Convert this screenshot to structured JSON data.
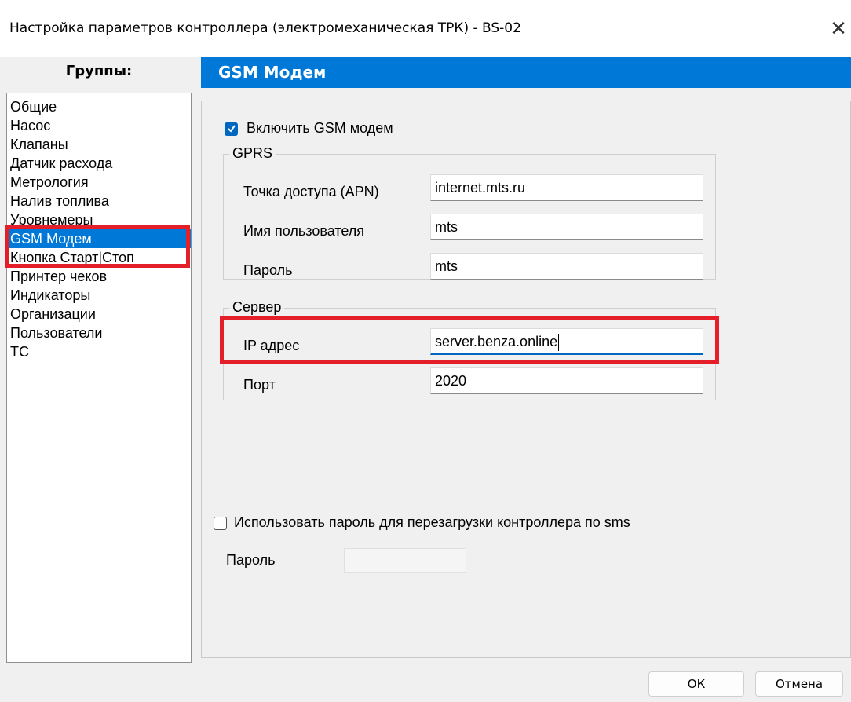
{
  "window": {
    "title": "Настройка параметров контроллера (электромеханическая ТРК) - BS-02",
    "close_glyph": "✕"
  },
  "groups": {
    "header": "Группы:",
    "items": [
      "Общие",
      "Насос",
      "Клапаны",
      "Датчик расхода",
      "Метрология",
      "Налив топлива",
      "Уровнемеры",
      "GSM Модем",
      "Кнопка Старт|Стоп",
      "Принтер чеков",
      "Индикаторы",
      "Организации",
      "Пользователи",
      "ТС"
    ],
    "selected": "GSM Модем"
  },
  "section": {
    "title": "GSM Модем"
  },
  "gsm": {
    "enable_label": "Включить GSM модем",
    "enable_checked": true
  },
  "gprs": {
    "title": "GPRS",
    "apn_label": "Точка доступа (APN)",
    "apn_value": "internet.mts.ru",
    "user_label": "Имя пользователя",
    "user_value": "mts",
    "password_label": "Пароль",
    "password_value": "mts"
  },
  "server": {
    "title": "Сервер",
    "ip_label": "IP адрес",
    "ip_value": "server.benza.online",
    "port_label": "Порт",
    "port_value": "2020"
  },
  "sms": {
    "use_password_label": "Использовать пароль для перезагрузки контроллера по sms",
    "use_password_checked": false,
    "password_label": "Пароль",
    "password_value": ""
  },
  "buttons": {
    "ok": "ОК",
    "cancel": "Отмена"
  },
  "colors": {
    "accent": "#0078d7",
    "highlight_box": "#e51f2a",
    "window_bg": "#f0f0f0"
  }
}
